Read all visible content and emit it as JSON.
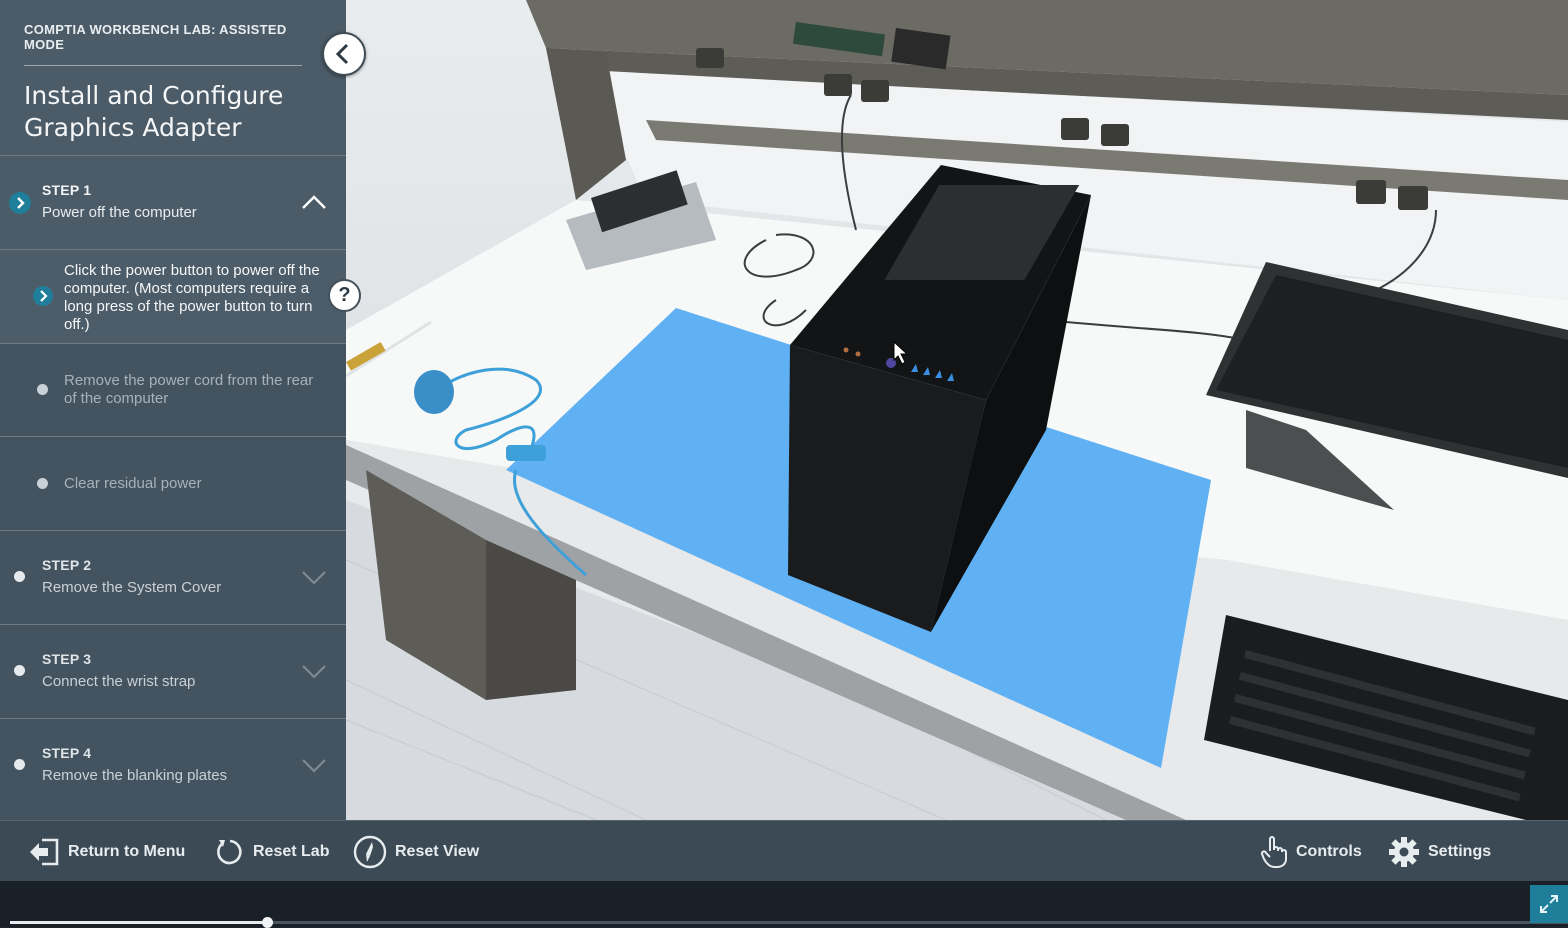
{
  "lab": {
    "kicker": "COMPTIA WORKBENCH LAB: ASSISTED MODE",
    "title_line1": "Install and Configure",
    "title_line2": "Graphics Adapter"
  },
  "steps": [
    {
      "label": "STEP 1",
      "description": "Power off the computer",
      "expanded": true,
      "substeps": [
        "Click the power button to power off the computer. (Most computers require a long press of the power button to turn off.)",
        "Remove the power cord from the rear of the computer",
        "Clear residual power"
      ]
    },
    {
      "label": "STEP 2",
      "description": "Remove the System Cover",
      "expanded": false
    },
    {
      "label": "STEP 3",
      "description": "Connect the wrist strap",
      "expanded": false
    },
    {
      "label": "STEP 4",
      "description": "Remove the blanking plates",
      "expanded": false
    }
  ],
  "toolbar": {
    "return_label": "Return to Menu",
    "reset_lab_label": "Reset Lab",
    "reset_view_label": "Reset View",
    "controls_label": "Controls",
    "settings_label": "Settings"
  },
  "icons": {
    "back": "chevron-left-icon",
    "help": "question-icon",
    "return": "exit-door-icon",
    "reset_lab": "rotate-icon",
    "reset_view": "compass-icon",
    "controls": "hand-pointer-icon",
    "settings": "gear-icon",
    "fullscreen": "expand-arrows-icon"
  },
  "help_glyph": "?",
  "progress_fraction": 0.165,
  "colors": {
    "sidebar_bg": "#43535f",
    "accent_teal": "#1f7f9a",
    "esd_mat": "#5fb1f4",
    "toolbar_bg": "#3c4a55"
  }
}
